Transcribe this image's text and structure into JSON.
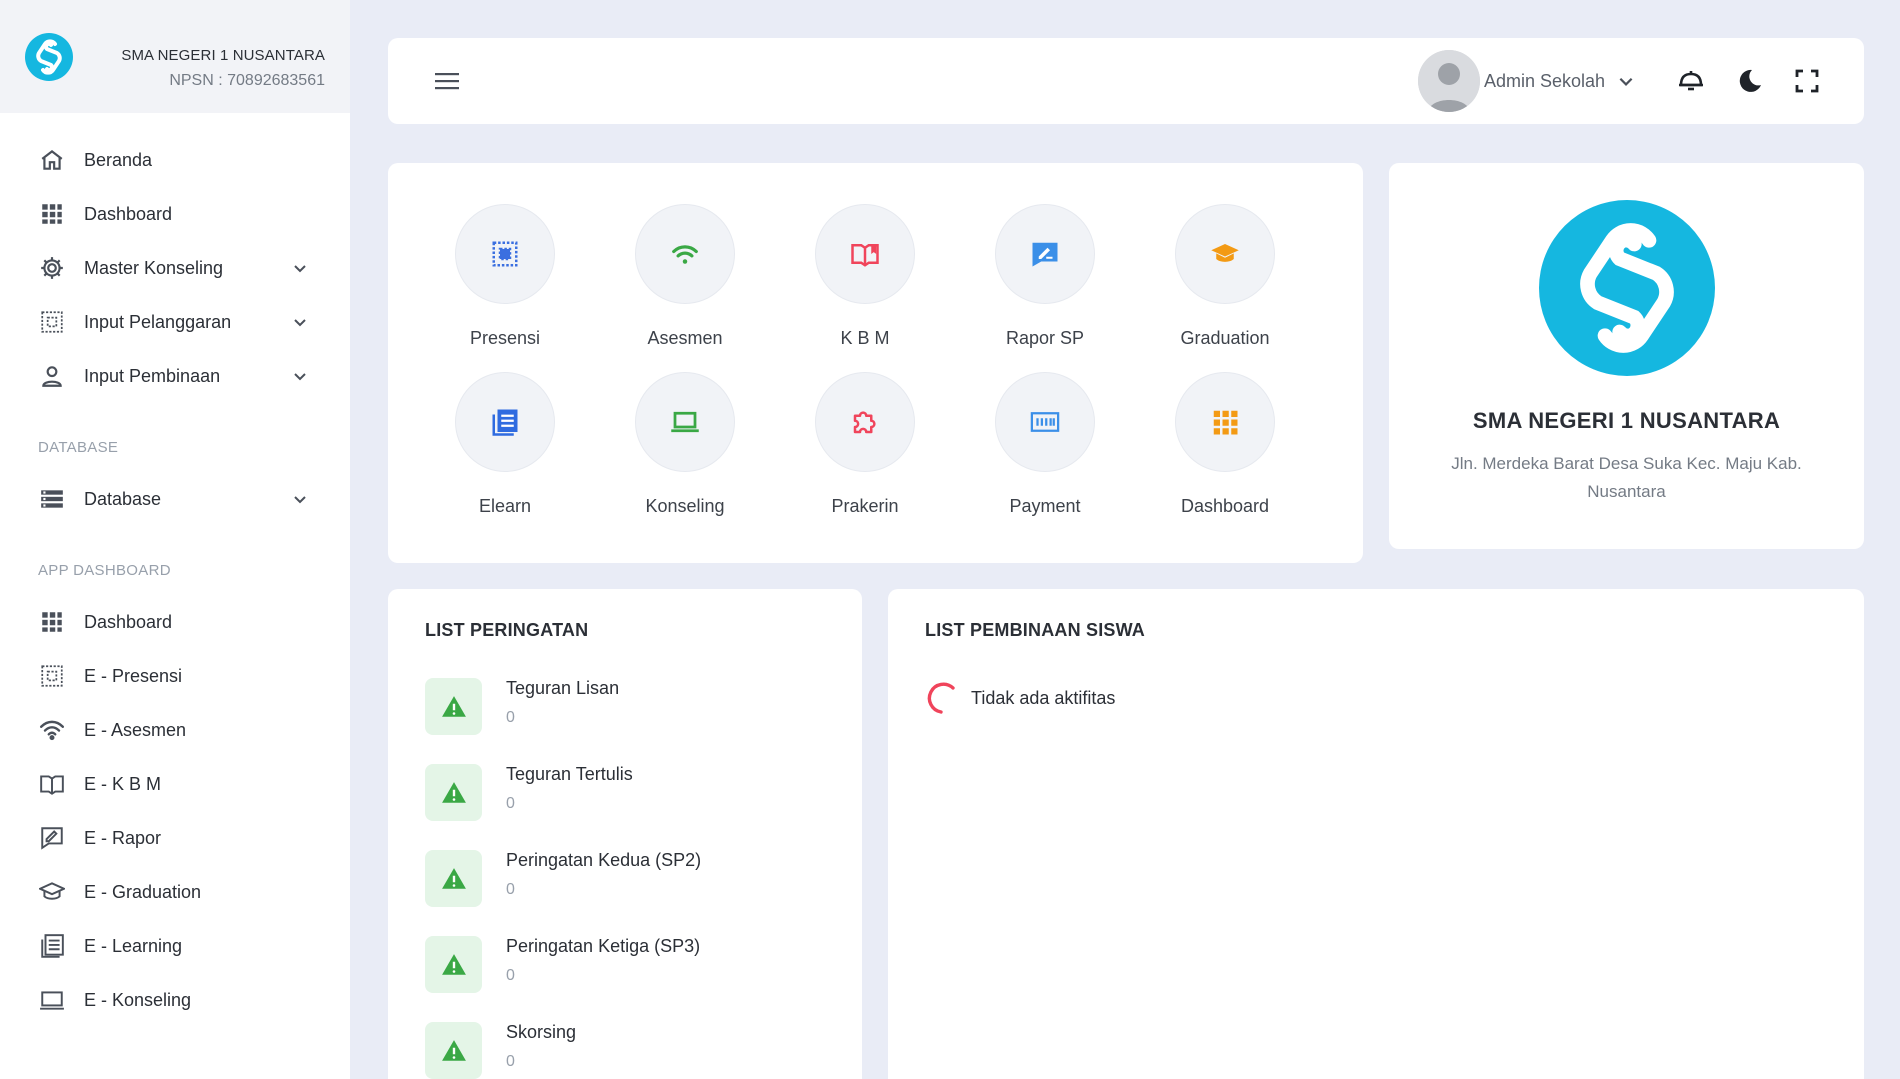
{
  "sidebar": {
    "school_name": "SMA NEGERI 1 NUSANTARA",
    "npsn": "NPSN : 70892683561",
    "menu": [
      {
        "label": "Beranda",
        "icon": "home-icon"
      },
      {
        "label": "Dashboard",
        "icon": "grid-icon"
      },
      {
        "label": "Master Konseling",
        "icon": "gear-icon",
        "expandable": true
      },
      {
        "label": "Input Pelanggaran",
        "icon": "scan-icon",
        "expandable": true
      },
      {
        "label": "Input Pembinaan",
        "icon": "user-icon",
        "expandable": true
      }
    ],
    "section_database": "DATABASE",
    "database_item": {
      "label": "Database",
      "icon": "database-icon",
      "expandable": true
    },
    "section_app": "APP DASHBOARD",
    "app_items": [
      {
        "label": "Dashboard",
        "icon": "grid-icon"
      },
      {
        "label": "E - Presensi",
        "icon": "scan-icon"
      },
      {
        "label": "E - Asesmen",
        "icon": "wifi-icon"
      },
      {
        "label": "E - K B M",
        "icon": "book-icon"
      },
      {
        "label": "E - Rapor",
        "icon": "edit-board-icon"
      },
      {
        "label": "E - Graduation",
        "icon": "graduation-cap-icon"
      },
      {
        "label": "E - Learning",
        "icon": "newspaper-icon"
      },
      {
        "label": "E - Konseling",
        "icon": "laptop-icon"
      }
    ]
  },
  "topbar": {
    "user_name": "Admin Sekolah"
  },
  "apps": [
    {
      "label": "Presensi",
      "icon": "scan-icon",
      "color": "#3b6fe0"
    },
    {
      "label": "Asesmen",
      "icon": "wifi-icon",
      "color": "#3aa845"
    },
    {
      "label": "K B M",
      "icon": "book-icon",
      "color": "#f0445b"
    },
    {
      "label": "Rapor SP",
      "icon": "edit-board-icon",
      "color": "#3b8fe8"
    },
    {
      "label": "Graduation",
      "icon": "graduation-cap-icon",
      "color": "#f39a14"
    },
    {
      "label": "Elearn",
      "icon": "newspaper-icon",
      "color": "#2f6be0"
    },
    {
      "label": "Konseling",
      "icon": "laptop-icon",
      "color": "#3aa845"
    },
    {
      "label": "Prakerin",
      "icon": "puzzle-icon",
      "color": "#f0445b"
    },
    {
      "label": "Payment",
      "icon": "payment-icon",
      "color": "#3b8fe8"
    },
    {
      "label": "Dashboard",
      "icon": "grid-icon",
      "color": "#f39a14"
    }
  ],
  "school": {
    "name": "SMA NEGERI 1 NUSANTARA",
    "address": "Jln. Merdeka Barat Desa Suka Kec. Maju Kab. Nusantara"
  },
  "warnings": {
    "title": "LIST PERINGATAN",
    "items": [
      {
        "label": "Teguran Lisan",
        "count": "0"
      },
      {
        "label": "Teguran Tertulis",
        "count": "0"
      },
      {
        "label": "Peringatan Kedua (SP2)",
        "count": "0"
      },
      {
        "label": "Peringatan Ketiga (SP3)",
        "count": "0"
      },
      {
        "label": "Skorsing",
        "count": "0"
      }
    ]
  },
  "pembinaan": {
    "title": "LIST PEMBINAAN SISWA",
    "empty_text": "Tidak ada aktifitas"
  },
  "colors": {
    "brand": "#15b7e0",
    "warning_green": "#3aa845",
    "spinner": "#f0445b"
  }
}
